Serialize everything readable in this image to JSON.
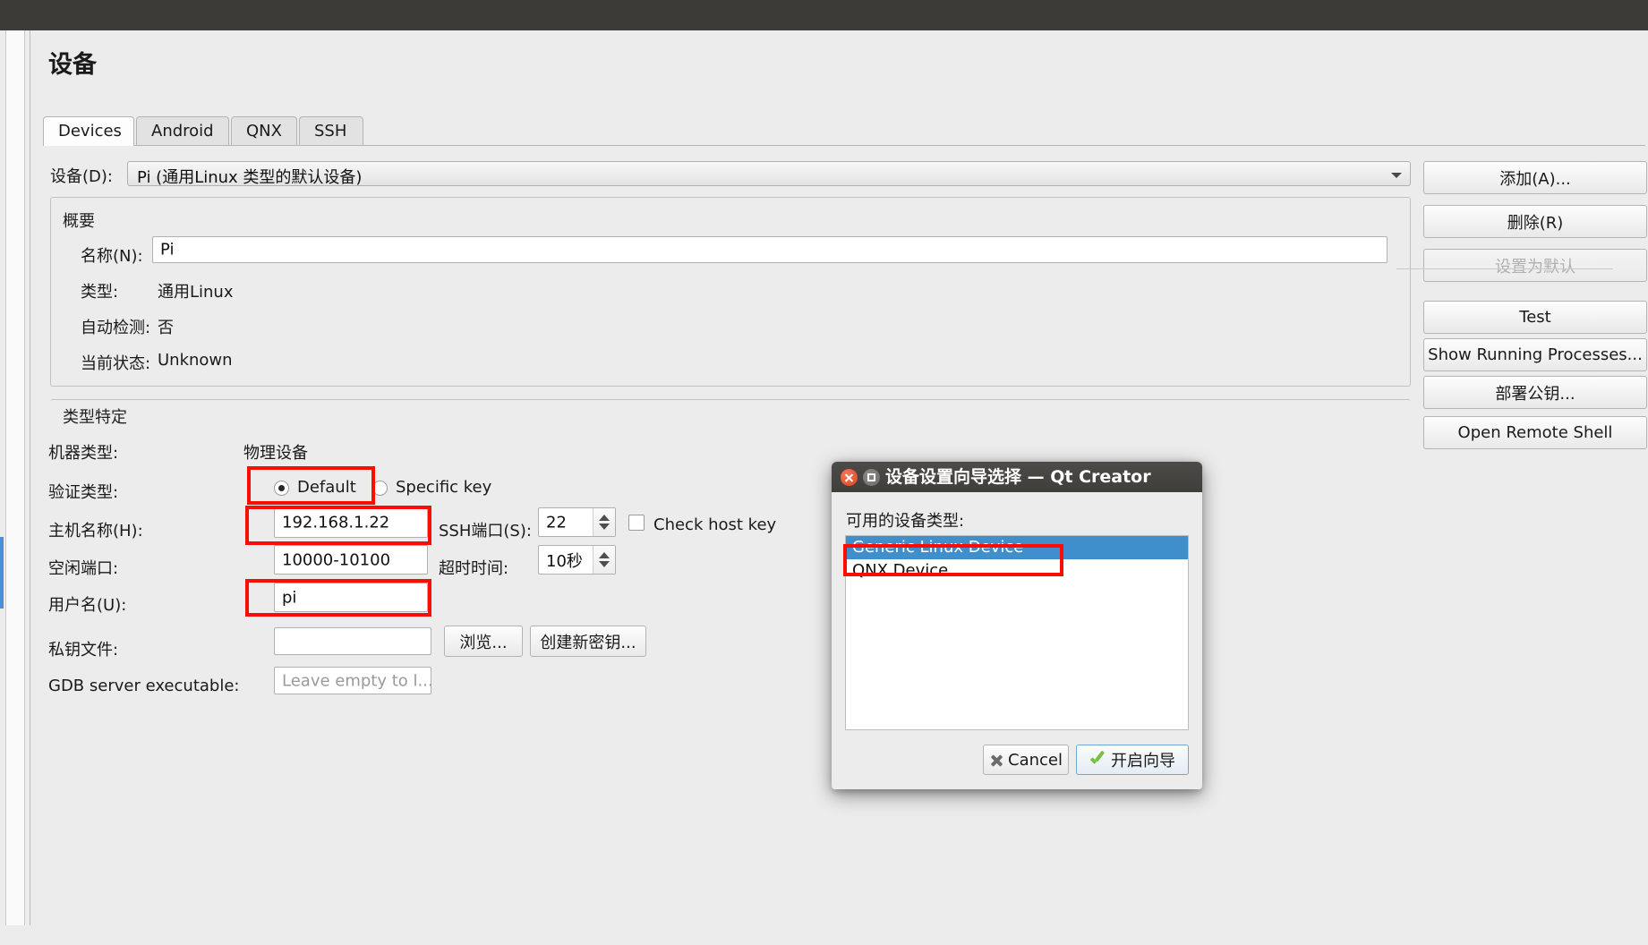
{
  "window": {
    "title_bar_color": "#3c3b37"
  },
  "page": {
    "title": "设备"
  },
  "tabs": [
    {
      "label": "Devices",
      "active": true
    },
    {
      "label": "Android",
      "active": false
    },
    {
      "label": "QNX",
      "active": false
    },
    {
      "label": "SSH",
      "active": false
    }
  ],
  "device_selector": {
    "label": "设备(D):",
    "value": "Pi (通用Linux 类型的默认设备)"
  },
  "summary": {
    "group_title": "概要",
    "name_label": "名称(N):",
    "name_value": "Pi",
    "type_label": "类型:",
    "type_value": "通用Linux",
    "autodetect_label": "自动检测:",
    "autodetect_value": "否",
    "state_label": "当前状态:",
    "state_value": "Unknown"
  },
  "type_specific": {
    "group_title": "类型特定",
    "machine_type_label": "机器类型:",
    "machine_type_value": "物理设备",
    "auth_type_label": "验证类型:",
    "auth_default_label": "Default",
    "auth_specific_label": "Specific key",
    "auth_selected": "Default",
    "host_label": "主机名称(H):",
    "host_value": "192.168.1.22",
    "ssh_port_label": "SSH端口(S):",
    "ssh_port_value": "22",
    "check_host_key_label": "Check host key",
    "check_host_key_checked": false,
    "free_ports_label": "空闲端口:",
    "free_ports_value": "10000-10100",
    "timeout_label": "超时时间:",
    "timeout_value": "10秒",
    "username_label": "用户名(U):",
    "username_value": "pi",
    "private_key_label": "私钥文件:",
    "private_key_value": "",
    "browse_button": "浏览...",
    "create_key_button": "创建新密钥...",
    "gdb_label": "GDB server executable:",
    "gdb_placeholder": "Leave empty to l..."
  },
  "side_buttons": [
    {
      "label": "添加(A)...",
      "disabled": false
    },
    {
      "label": "删除(R)",
      "disabled": false
    },
    {
      "label": "设置为默认",
      "disabled": true
    },
    {
      "label": "Test",
      "disabled": false
    },
    {
      "label": "Show Running Processes...",
      "disabled": false
    },
    {
      "label": "部署公钥...",
      "disabled": false
    },
    {
      "label": "Open Remote Shell",
      "disabled": false
    }
  ],
  "dialog": {
    "title": "设备设置向导选择 — Qt Creator",
    "list_label": "可用的设备类型:",
    "items": [
      {
        "label": "Generic Linux Device",
        "selected": true
      },
      {
        "label": "QNX Device",
        "selected": false
      }
    ],
    "cancel_button": "Cancel",
    "ok_button": "开启向导"
  },
  "highlight_color": "#fb0d04"
}
